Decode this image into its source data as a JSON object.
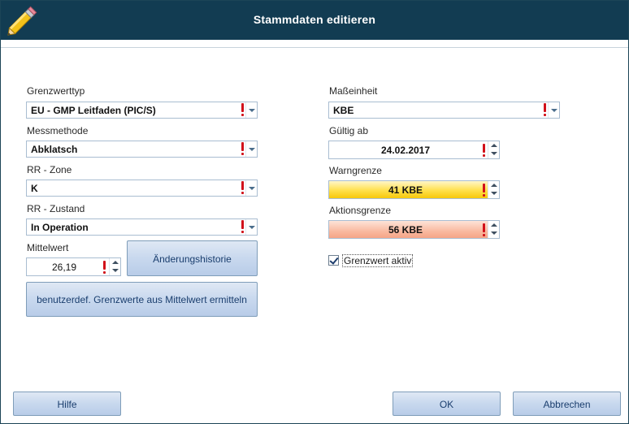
{
  "window": {
    "title": "Stammdaten editieren"
  },
  "left": {
    "grenzwerttyp": {
      "label": "Grenzwerttyp",
      "value": "EU - GMP Leitfaden (PIC/S)"
    },
    "messmethode": {
      "label": "Messmethode",
      "value": "Abklatsch"
    },
    "rr_zone": {
      "label": "RR - Zone",
      "value": "K"
    },
    "rr_zustand": {
      "label": "RR - Zustand",
      "value": "In Operation"
    },
    "mittelwert": {
      "label": "Mittelwert",
      "value": "26,19"
    },
    "aenderungshistorie_button": "Änderungshistorie",
    "ermitteln_button": "benutzerdef. Grenzwerte aus Mittelwert ermitteln"
  },
  "right": {
    "masseinheit": {
      "label": "Maßeinheit",
      "value": "KBE"
    },
    "gueltig_ab": {
      "label": "Gültig ab",
      "value": "24.02.2017"
    },
    "warngrenze": {
      "label": "Warngrenze",
      "value": "41 KBE"
    },
    "aktionsgrenze": {
      "label": "Aktionsgrenze",
      "value": "56 KBE"
    },
    "grenzwert_aktiv": {
      "label": "Grenzwert aktiv",
      "checked": true
    }
  },
  "footer": {
    "hilfe": "Hilfe",
    "ok": "OK",
    "abbrechen": "Abbrechen"
  },
  "icons": {
    "title": "pencil-icon",
    "required": "exclamation-icon",
    "dropdown": "chevron-down-icon"
  },
  "colors": {
    "titlebar": "#123c52",
    "warn": "#ffe04a",
    "action": "#f9b9a0",
    "required": "#d1101a"
  }
}
